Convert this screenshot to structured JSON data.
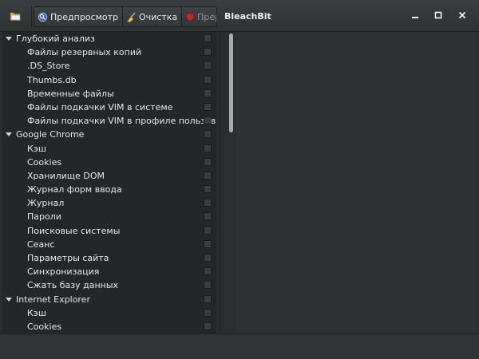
{
  "window": {
    "title": "BleachBit",
    "menu_icon": "open-menu-icon",
    "controls": [
      "minimize-icon",
      "maximize-icon",
      "close-icon"
    ]
  },
  "toolbar": {
    "preview_label": "Предпросмотр",
    "clean_label": "Очистка",
    "abort_label": "Прервать",
    "preview_icon": "magnifier-icon",
    "clean_icon": "broom-icon",
    "abort_icon": "stop-icon",
    "abort_disabled": true
  },
  "tree": {
    "groups": [
      {
        "label": "Глубокий анализ",
        "items": [
          "Файлы резервных копий",
          ".DS_Store",
          "Thumbs.db",
          "Временные файлы",
          "Файлы подкачки VIM в системе",
          "Файлы подкачки VIM в профиле пользователя"
        ]
      },
      {
        "label": "Google Chrome",
        "items": [
          "Кэш",
          "Cookies",
          "Хранилище DOM",
          "Журнал форм ввода",
          "Журнал",
          "Пароли",
          "Поисковые системы",
          "Сеанс",
          "Параметры сайта",
          "Синхронизация",
          "Сжать базу данных"
        ]
      },
      {
        "label": "Internet Explorer",
        "items": [
          "Кэш",
          "Cookies"
        ]
      }
    ]
  },
  "colors": {
    "background": "#2b2d2e",
    "tree_background": "#242627",
    "text": "#e6e6e6",
    "disabled_text": "#8f9294",
    "stop_red": "#c0302f"
  }
}
